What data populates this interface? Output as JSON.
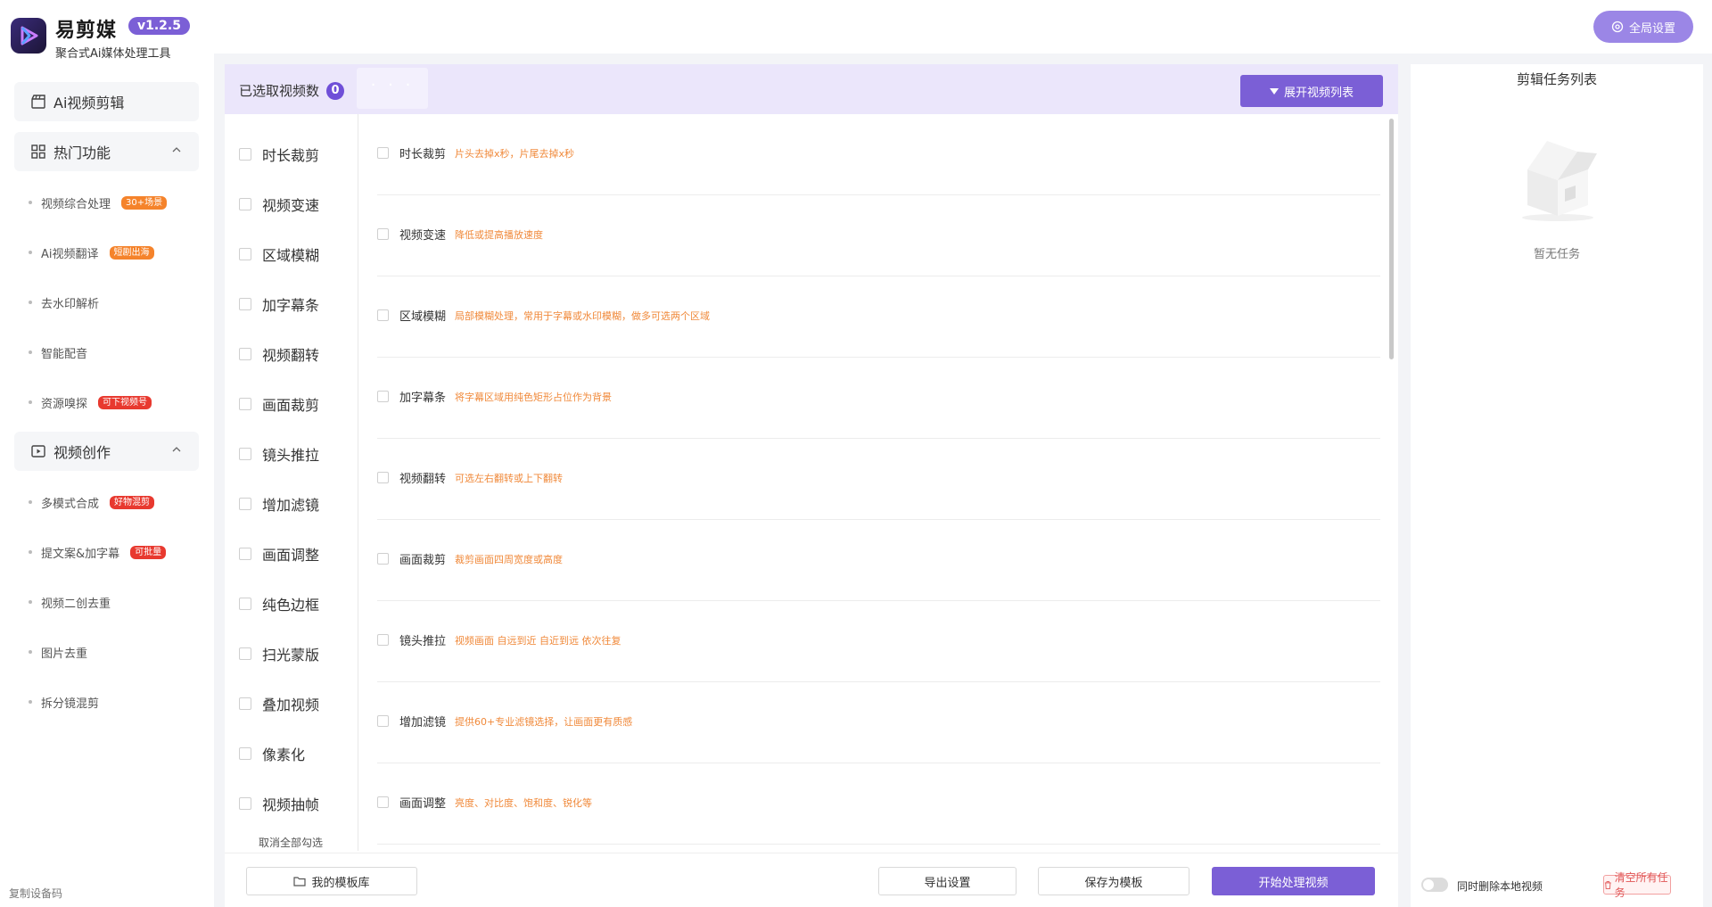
{
  "brand": {
    "name": "易剪媒",
    "version": "v1.2.5",
    "subtitle": "聚合式Ai媒体处理工具"
  },
  "global_settings": "全局设置",
  "sidebar": {
    "ai_edit": "Ai视频剪辑",
    "hot_section": "热门功能",
    "hot_items": [
      {
        "label": "视频综合处理",
        "badge": "30+场景",
        "badge_color": "#f5832b"
      },
      {
        "label": "Ai视频翻译",
        "badge": "短剧出海",
        "badge_color": "#f5832b"
      },
      {
        "label": "去水印解析"
      },
      {
        "label": "智能配音"
      },
      {
        "label": "资源嗅探",
        "badge": "可下视频号",
        "badge_color": "#e8392f"
      }
    ],
    "create_section": "视频创作",
    "create_items": [
      {
        "label": "多模式合成",
        "badge": "好物混剪",
        "badge_color": "#e8392f"
      },
      {
        "label": "提文案&加字幕",
        "badge": "可批量",
        "badge_color": "#e8392f"
      },
      {
        "label": "视频二创去重"
      },
      {
        "label": "图片去重"
      },
      {
        "label": "拆分镜混剪"
      }
    ],
    "copy_device": "复制设备码"
  },
  "main": {
    "selected_label": "已选取视频数",
    "selected_count": "0",
    "dots": "· · ·",
    "expand_button": "展开视频列表",
    "features": [
      "时长裁剪",
      "视频变速",
      "区域模糊",
      "加字幕条",
      "视频翻转",
      "画面裁剪",
      "镜头推拉",
      "增加滤镜",
      "画面调整",
      "纯色边框",
      "扫光蒙版",
      "叠加视频",
      "像素化",
      "视频抽帧"
    ],
    "cancel_all": "取消全部勾选",
    "details": [
      {
        "title": "时长裁剪",
        "desc": "片头去掉x秒，片尾去掉x秒"
      },
      {
        "title": "视频变速",
        "desc": "降低或提高播放速度"
      },
      {
        "title": "区域模糊",
        "desc": "局部模糊处理，常用于字幕或水印模糊，做多可选两个区域"
      },
      {
        "title": "加字幕条",
        "desc": "将字幕区域用纯色矩形占位作为背景"
      },
      {
        "title": "视频翻转",
        "desc": "可选左右翻转或上下翻转"
      },
      {
        "title": "画面裁剪",
        "desc": "裁剪画面四周宽度或高度"
      },
      {
        "title": "镜头推拉",
        "desc": "视频画面 自远到近 自近到远 依次往复"
      },
      {
        "title": "增加滤镜",
        "desc": "提供60+专业滤镜选择，让画面更有质感"
      },
      {
        "title": "画面调整",
        "desc": "亮度、对比度、饱和度、锐化等"
      }
    ],
    "footer": {
      "template_library": "我的模板库",
      "export_settings": "导出设置",
      "save_template": "保存为模板",
      "start": "开始处理视频"
    }
  },
  "tasks": {
    "title": "剪辑任务列表",
    "empty": "暂无任务",
    "delete_local": "同时删除本地视频",
    "clear_all": "清空所有任务"
  }
}
